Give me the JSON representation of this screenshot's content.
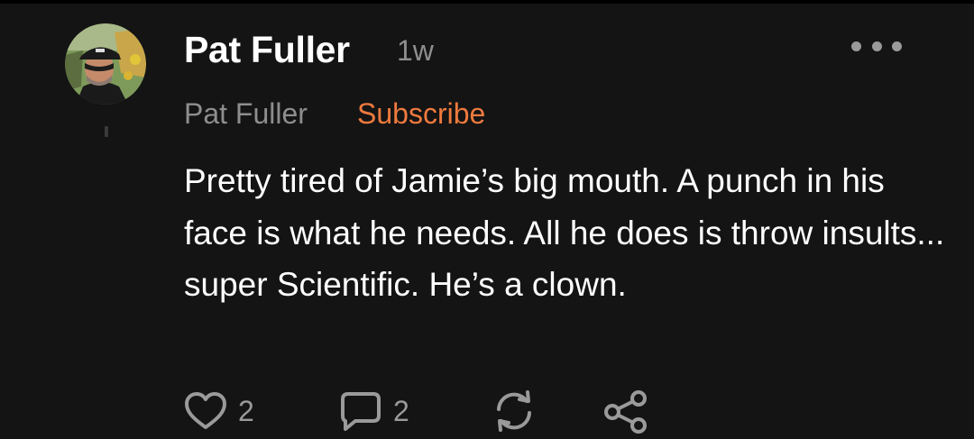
{
  "comment": {
    "author": "Pat Fuller",
    "time_ago": "1w",
    "publication_name": "Pat Fuller",
    "subscribe_label": "Subscribe",
    "body": "Pretty tired of Jamie’s big mouth. A punch in his face is what he needs. All he does is throw insults... super Scientific. He’s a clown."
  },
  "actions": {
    "like_count": "2",
    "reply_count": "2",
    "like_icon": "heart-outline-icon",
    "reply_icon": "speech-bubble-icon",
    "restack_icon": "restack-icon",
    "share_icon": "share-icon"
  },
  "colors": {
    "background": "#141414",
    "text": "#ffffff",
    "muted": "#8e8e8e",
    "accent": "#ee7a3e"
  }
}
